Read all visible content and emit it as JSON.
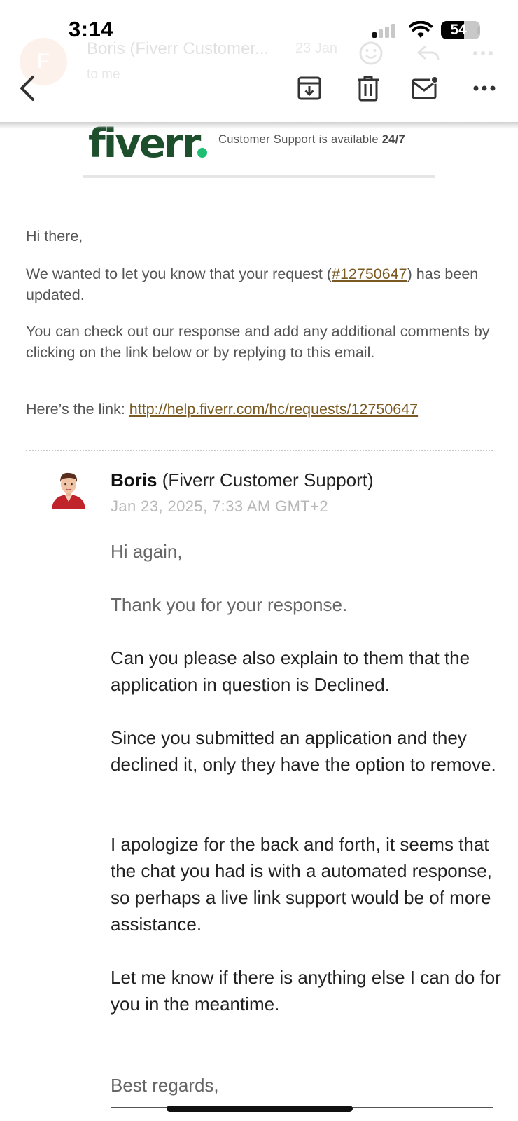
{
  "status_bar": {
    "time": "3:14",
    "battery_level": "54",
    "battery_percent": 54
  },
  "ghost_header": {
    "avatar_letter": "F",
    "sender": "Boris (Fiverr Customer...",
    "date": "23 Jan",
    "recipient": "to me"
  },
  "toolbar": {
    "back_icon": "chevron-left-icon",
    "archive_icon": "archive-icon",
    "delete_icon": "trash-icon",
    "unread_icon": "mail-unread-icon",
    "more_icon": "more-horizontal-icon"
  },
  "email": {
    "brand": "fiverr",
    "support_note": "Customer Support is available",
    "support_hours": "24/7",
    "greeting": "Hi there,",
    "update_prefix": "We wanted to let you know that your request (",
    "request_id": "#12750647",
    "update_suffix": ") has been updated.",
    "check_out_text": "You can check out our response and add any additional comments by clicking on the link below or by replying to this email.",
    "link_prefix": "Here’s the link: ",
    "link_url": "http://help.fiverr.com/hc/requests/12750647"
  },
  "reply": {
    "author_name": "Boris",
    "author_org": "(Fiverr Customer Support)",
    "timestamp": "Jan 23, 2025, 7:33 AM GMT+2",
    "paragraphs": [
      "Hi again,",
      "Thank you for your response.",
      "Can you please also explain to them that the application in question is Declined.",
      "Since you submitted an application and they declined it, only they have the option to remove.",
      "I apologize for the back and forth, it seems that the chat you had is with a automated response, so perhaps a live link support would be of more assistance.",
      "Let me know if there is anything else I can do for you in the meantime.",
      "Best regards,"
    ]
  },
  "colors": {
    "brand_green": "#1d4f2c",
    "brand_dot": "#1dbf73",
    "link": "#7a5a22"
  }
}
